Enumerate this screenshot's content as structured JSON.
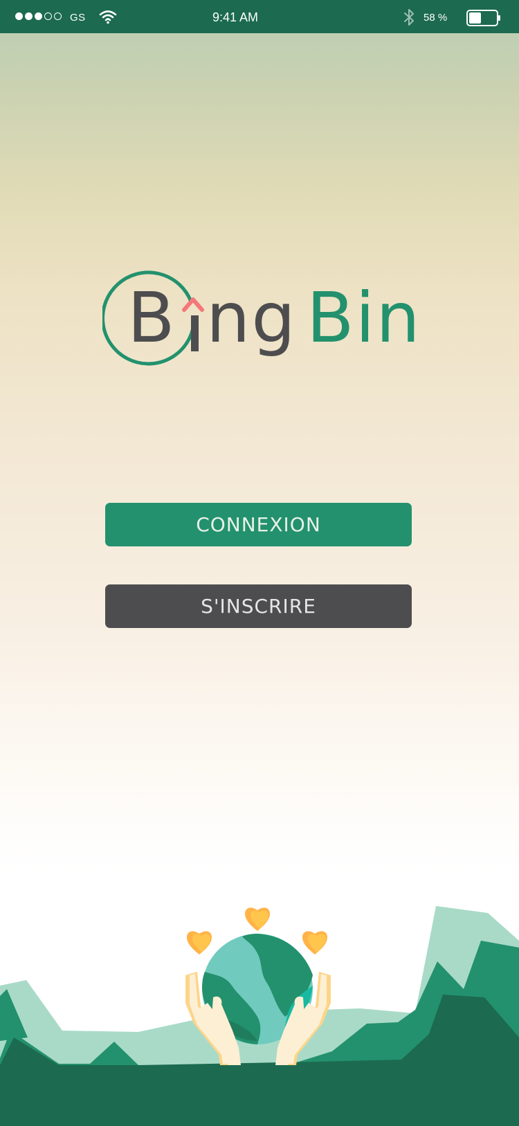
{
  "status_bar": {
    "signal_icon": "signal-strength-icon",
    "carrier": "GS",
    "wifi_icon": "wifi-icon",
    "time": "9:41 AM",
    "bluetooth_icon": "bluetooth-icon",
    "battery_percent": "58 %",
    "battery_icon": "battery-icon",
    "battery_level": 0.58
  },
  "logo": {
    "part_b": "B",
    "part_gray": "ng",
    "part_green": "Bin",
    "full_text": "BingBin"
  },
  "buttons": {
    "login_label": "CONNEXION",
    "signup_label": "S'INSCRIRE"
  },
  "colors": {
    "brand_green": "#23916d",
    "dark_green": "#1c6a50",
    "charcoal": "#4d4d4f",
    "accent_pink": "#f47779",
    "heart_yellow": "#ffc54d"
  },
  "illustration": {
    "icon": "earth-in-hands-icon"
  }
}
